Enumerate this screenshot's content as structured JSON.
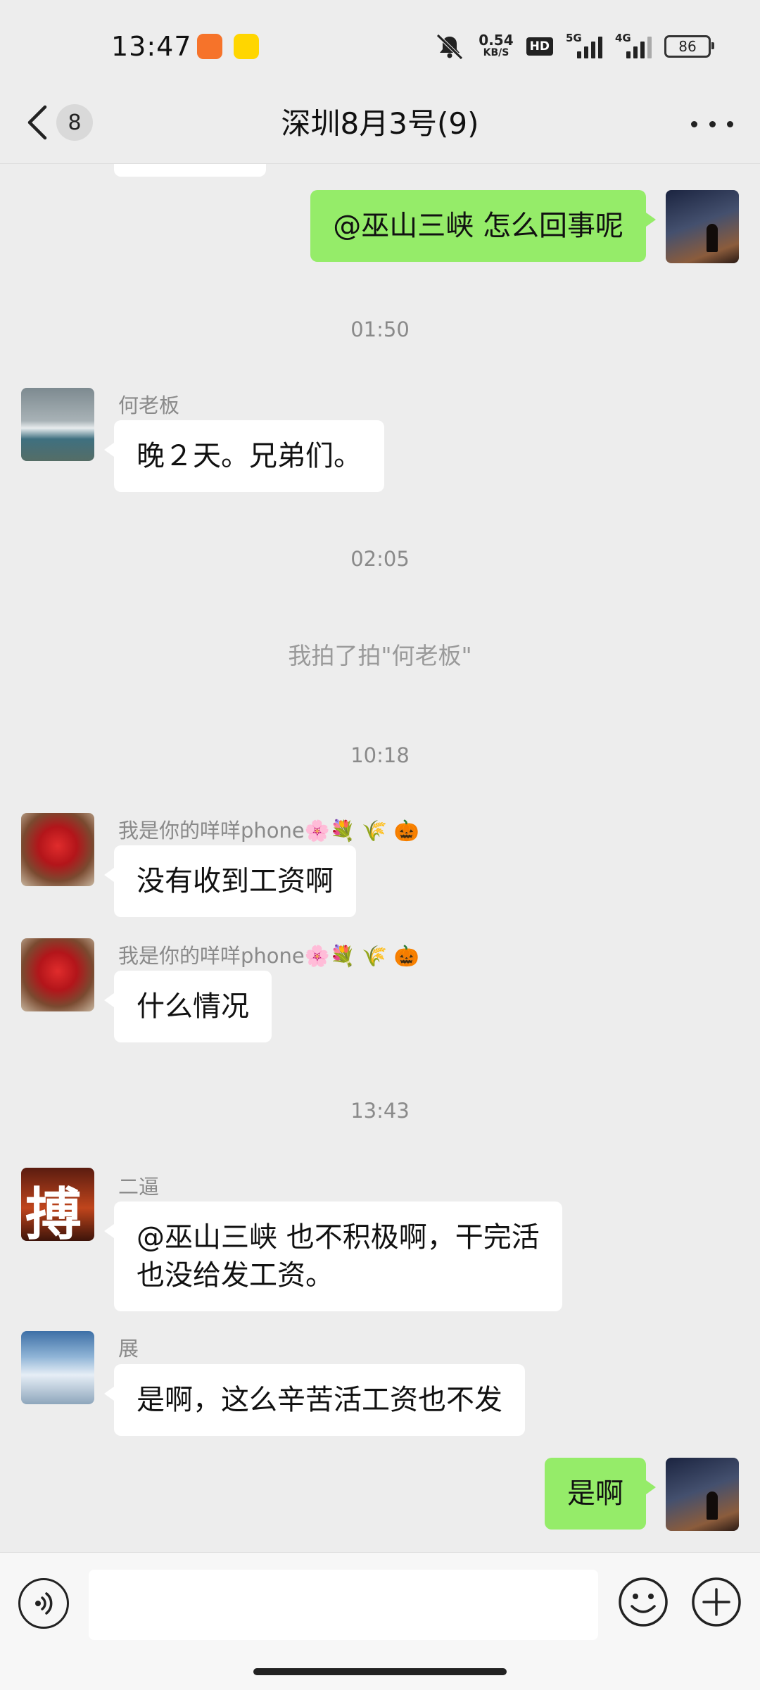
{
  "status_bar": {
    "time": "13:47",
    "net_speed_value": "0.54",
    "net_speed_unit": "KB/S",
    "hd_label": "HD",
    "signal1_label": "5G",
    "signal2_label": "4G",
    "battery": "86",
    "icons": [
      "orange-app-icon",
      "yellow-app-icon",
      "mute-bell-icon",
      "signal-icon",
      "battery-icon"
    ]
  },
  "nav": {
    "back_badge": "8",
    "title": "深圳8月3号(9)"
  },
  "messages": [
    {
      "type": "outgoing",
      "text": "@巫山三峡  怎么回事呢"
    },
    {
      "type": "time",
      "text": "01:50"
    },
    {
      "type": "incoming",
      "sender": "何老板",
      "text": "晚２天。兄弟们。"
    },
    {
      "type": "time",
      "text": "02:05"
    },
    {
      "type": "system",
      "text": "我拍了拍\"何老板\""
    },
    {
      "type": "time",
      "text": "10:18"
    },
    {
      "type": "incoming",
      "sender": "我是你的咩咩phone🌸💐 🌾 🎃",
      "text": "没有收到工资啊"
    },
    {
      "type": "incoming",
      "sender": "我是你的咩咩phone🌸💐 🌾 🎃",
      "text": "什么情况"
    },
    {
      "type": "time",
      "text": "13:43"
    },
    {
      "type": "incoming",
      "sender": "二逼",
      "text_line1": "@巫山三峡  也不积极啊，干完活",
      "text_line2": "也没给发工资。",
      "avatar_char": "搏"
    },
    {
      "type": "incoming",
      "sender": "展",
      "text": "是啊，这么辛苦活工资也不发"
    },
    {
      "type": "outgoing",
      "text": "是啊"
    }
  ],
  "input": {
    "value": "",
    "placeholder": ""
  },
  "colors": {
    "background": "#ededed",
    "outgoing_bubble": "#95ec69",
    "incoming_bubble": "#ffffff"
  }
}
